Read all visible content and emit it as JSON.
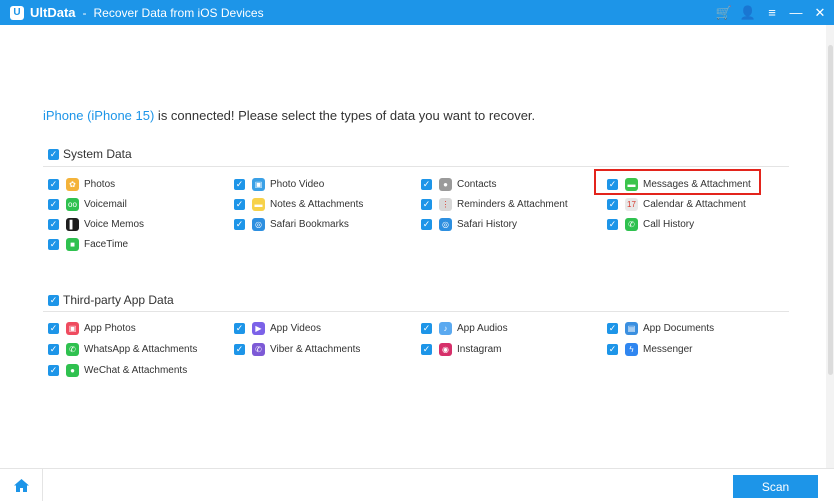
{
  "titlebar": {
    "app_name": "UltData",
    "separator": "-",
    "title": "Recover Data from iOS Devices",
    "buttons": [
      {
        "name": "cart-icon",
        "glyph": "🛒"
      },
      {
        "name": "user-icon",
        "glyph": "👤"
      },
      {
        "name": "menu-icon",
        "glyph": "≡"
      },
      {
        "name": "minimize-icon",
        "glyph": "—"
      },
      {
        "name": "close-icon",
        "glyph": "✕"
      }
    ]
  },
  "headline": {
    "device": "iPhone (iPhone 15)",
    "rest": " is connected! Please select the types of data you want to recover."
  },
  "system": {
    "label": "System Data",
    "checked": true,
    "items": [
      {
        "label": "Photos",
        "icon": "photos-icon",
        "color": "#f4b33a",
        "glyph": "✿",
        "checked": true
      },
      {
        "label": "Photo Video",
        "icon": "photo-video-icon",
        "color": "#3aa0e6",
        "glyph": "▣",
        "checked": true
      },
      {
        "label": "Contacts",
        "icon": "contacts-icon",
        "color": "#9a9a9a",
        "glyph": "●",
        "checked": true
      },
      {
        "label": "Messages & Attachment",
        "icon": "messages-icon",
        "color": "#3bc44b",
        "glyph": "▬",
        "checked": true
      },
      {
        "label": "Voicemail",
        "icon": "voicemail-icon",
        "color": "#2fc14f",
        "glyph": "oo",
        "checked": true
      },
      {
        "label": "Notes & Attachments",
        "icon": "notes-icon",
        "color": "#f7d24a",
        "glyph": "▬",
        "checked": true
      },
      {
        "label": "Reminders & Attachment",
        "icon": "reminders-icon",
        "color": "#d7d7d7",
        "glyph": "⋮",
        "checked": true
      },
      {
        "label": "Calendar & Attachment",
        "icon": "calendar-icon",
        "color": "#e8e8e8",
        "glyph": "17",
        "checked": true
      },
      {
        "label": "Voice Memos",
        "icon": "voice-memos-icon",
        "color": "#1e1e1e",
        "glyph": "▌",
        "checked": true
      },
      {
        "label": "Safari Bookmarks",
        "icon": "safari-bookmarks-icon",
        "color": "#2d8fe0",
        "glyph": "◎",
        "checked": true
      },
      {
        "label": "Safari History",
        "icon": "safari-history-icon",
        "color": "#2d8fe0",
        "glyph": "◎",
        "checked": true
      },
      {
        "label": "Call History",
        "icon": "call-history-icon",
        "color": "#2fc14f",
        "glyph": "✆",
        "checked": true
      },
      {
        "label": "FaceTime",
        "icon": "facetime-icon",
        "color": "#2fc14f",
        "glyph": "■",
        "checked": true
      }
    ]
  },
  "thirdparty": {
    "label": "Third-party App Data",
    "checked": true,
    "items": [
      {
        "label": "App Photos",
        "icon": "app-photos-icon",
        "color": "#ef4b5f",
        "glyph": "▣",
        "checked": true
      },
      {
        "label": "App Videos",
        "icon": "app-videos-icon",
        "color": "#7b62e8",
        "glyph": "▶",
        "checked": true
      },
      {
        "label": "App Audios",
        "icon": "app-audios-icon",
        "color": "#5aa9f0",
        "glyph": "♪",
        "checked": true
      },
      {
        "label": "App Documents",
        "icon": "app-documents-icon",
        "color": "#3a8fe0",
        "glyph": "▤",
        "checked": true
      },
      {
        "label": "WhatsApp & Attachments",
        "icon": "whatsapp-icon",
        "color": "#2fc14f",
        "glyph": "✆",
        "checked": true
      },
      {
        "label": "Viber & Attachments",
        "icon": "viber-icon",
        "color": "#7d5ad6",
        "glyph": "✆",
        "checked": true
      },
      {
        "label": "Instagram",
        "icon": "instagram-icon",
        "color": "#d6306a",
        "glyph": "◉",
        "checked": true
      },
      {
        "label": "Messenger",
        "icon": "messenger-icon",
        "color": "#2f86f0",
        "glyph": "ϟ",
        "checked": true
      },
      {
        "label": "WeChat & Attachments",
        "icon": "wechat-icon",
        "color": "#2fc14f",
        "glyph": "●",
        "checked": true
      }
    ]
  },
  "footer": {
    "home_glyph": "⌂",
    "scan_label": "Scan"
  },
  "checkmark": "✓",
  "colors": {
    "accent": "#1d95e8",
    "highlight": "#e3241c"
  }
}
